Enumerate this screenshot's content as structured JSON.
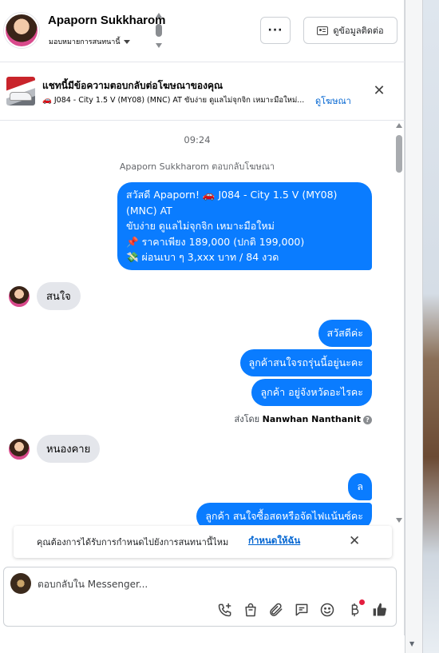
{
  "header": {
    "name": "Apaporn Sukkharom",
    "assign_label": "มอบหมายการสนทนานี้",
    "more_label": "···",
    "contact_info_label": "ดูข้อมูลติดต่อ"
  },
  "ad_banner": {
    "title": "แชทนี้มีข้อความตอบกลับต่อโฆษณาของคุณ",
    "subtitle": "🚗 J084 - City 1.5 V (MY08) (MNC) AT ขับง่าย ดูแลไม่จุกจิก เหมาะมือใหม่...",
    "link": "ดูโฆษณา",
    "close": "✕"
  },
  "messages": {
    "time": "09:24",
    "system": "Apaporn Sukkharom ตอบกลับโฆษณา",
    "ad_message_lines": [
      "สวัสดี Apaporn! 🚗 J084 - City 1.5 V (MY08)",
      "(MNC) AT",
      "ขับง่าย ดูแลไม่จุกจิก เหมาะมือใหม่",
      "📌 ราคาเพียง 189,000 (ปกติ 199,000)",
      "💸 ผ่อนเบา ๆ 3,xxx บาท / 84 งวด"
    ],
    "in_1": "สนใจ",
    "out_1": "สวัสดีค่ะ",
    "out_2": "ลูกค้าสนใจรถรุ่นนี้อยู่นะคะ",
    "out_3": "ลูกค้า อยู่จังหวัดอะไรคะ",
    "sent_by_prefix": "ส่งโดย",
    "sent_by_name": "Nanwhan Nanthanit",
    "in_2": "หนองคาย",
    "out_4": "ล",
    "out_5": "ลูกค้า สนใจซื้อสดหรือจัดไฟแน้นซ์คะ"
  },
  "suggestion": {
    "text": "คุณต้องการได้รับการกำหนดไปยังการสนทนานี้ไหม",
    "link": "กำหนดให้ฉัน",
    "close": "✕"
  },
  "composer": {
    "placeholder": "ตอบกลับใน Messenger..."
  },
  "colors": {
    "accent": "#0a7cff",
    "incoming": "#e4e6eb",
    "link": "#0064d1"
  },
  "icons": [
    "phone-plus-icon",
    "shopping-bag-icon",
    "paperclip-icon",
    "saved-reply-icon",
    "emoji-icon",
    "baht-icon",
    "like-icon"
  ]
}
